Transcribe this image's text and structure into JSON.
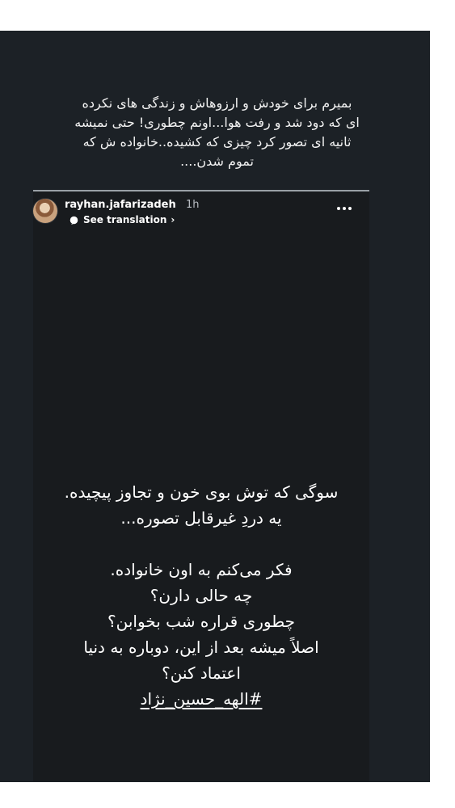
{
  "story": {
    "caption_lines": [
      "بمیرم برای خودش و ارزوهاش و زندگی های نکرده",
      "ای که دود شد و رفت هوا...اونم چطوری! حتی نمیشه",
      "ثانیه ای تصور کرد چیزی که کشیده..خانواده ش که",
      "تموم شدن...."
    ]
  },
  "post": {
    "username": "rayhan.jafarizadeh",
    "time": "1h",
    "see_translation": "See translation",
    "body_lines": [
      "سوگی که توش بوی خون و تجاوز پیچیده.",
      "یه دردِ غیرقابل تصوره...",
      "فکر می‌کنم به اون خانواده.",
      "چه حالی دارن؟",
      "چطوری قراره شب بخوابن؟",
      "اصلاً میشه بعد از این، دوباره به دنیا",
      "اعتماد کنن؟"
    ],
    "hashtag": "#الهه_حسین_نژاد"
  },
  "icons": {
    "avatar": "profile-photo",
    "translate": "translate-icon",
    "chevron": "chevron-right-icon",
    "more": "more-options-icon"
  },
  "colors": {
    "story_background": "#1c2126",
    "post_background": "#181b1e",
    "text": "#ffffff"
  }
}
